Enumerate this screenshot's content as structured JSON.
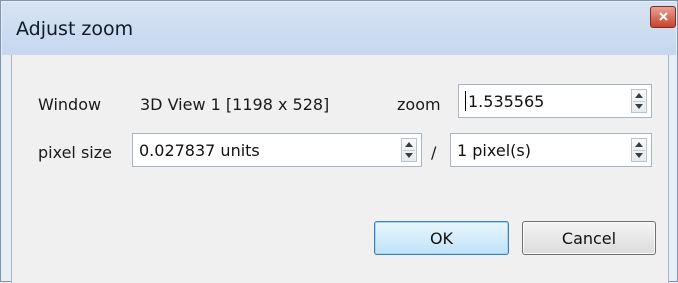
{
  "window": {
    "title": "Adjust zoom",
    "close_icon": "close-icon"
  },
  "row1": {
    "window_label": "Window",
    "window_value": "3D View 1 [1198 x 528]",
    "zoom_label": "zoom",
    "zoom_value": "1.535565"
  },
  "row2": {
    "pixel_size_label": "pixel size",
    "pixel_size_value": "0.027837 units",
    "separator": "/",
    "pixels_value": "1 pixel(s)"
  },
  "buttons": {
    "ok_label": "OK",
    "cancel_label": "Cancel"
  },
  "colors": {
    "close_button": "#c7432b",
    "ok_border": "#3c7fb1"
  }
}
